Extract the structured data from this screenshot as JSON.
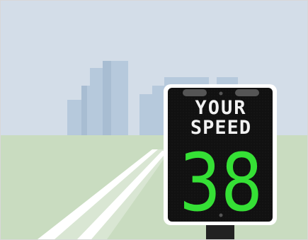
{
  "scene": {
    "sky_color": "#d3dde8",
    "grass_color": "#c9dcc0",
    "building_color": "#b6c9dc",
    "road_color": "#ffffff",
    "pole_color": "#222222",
    "sign_frame_color": "#ffffff",
    "sign_panel_color": "#111111"
  },
  "sign": {
    "line1": "YOUR",
    "line2": "SPEED",
    "speed": "38",
    "text_color": "#f2f2f2",
    "speed_color": "#35e035",
    "beacon_color": "#555555"
  }
}
